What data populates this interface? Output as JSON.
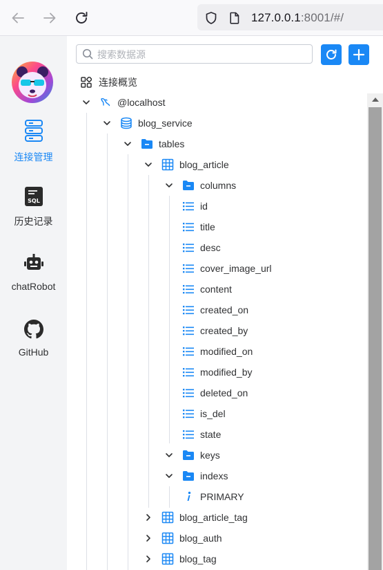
{
  "browser": {
    "url_host": "127.0.0.1",
    "url_rest": ":8001/#/"
  },
  "sidebar": {
    "items": [
      {
        "label": "连接管理",
        "icon": "database-server-icon",
        "active": true
      },
      {
        "label": "历史记录",
        "icon": "sql-history-icon",
        "active": false
      },
      {
        "label": "chatRobot",
        "icon": "robot-icon",
        "active": false
      },
      {
        "label": "GitHub",
        "icon": "github-icon",
        "active": false
      }
    ]
  },
  "search": {
    "placeholder": "搜索数据源"
  },
  "overview_label": "连接概览",
  "tree": {
    "connection": "@localhost",
    "database": "blog_service",
    "tables_folder": "tables",
    "table_open": "blog_article",
    "columns_folder": "columns",
    "columns": [
      "id",
      "title",
      "desc",
      "cover_image_url",
      "content",
      "created_on",
      "created_by",
      "modified_on",
      "modified_by",
      "deleted_on",
      "is_del",
      "state"
    ],
    "keys_folder": "keys",
    "indexs_folder": "indexs",
    "index_item": "PRIMARY",
    "other_tables": [
      "blog_article_tag",
      "blog_auth",
      "blog_tag"
    ]
  },
  "colors": {
    "accent": "#1a88f5",
    "text": "#303133"
  }
}
